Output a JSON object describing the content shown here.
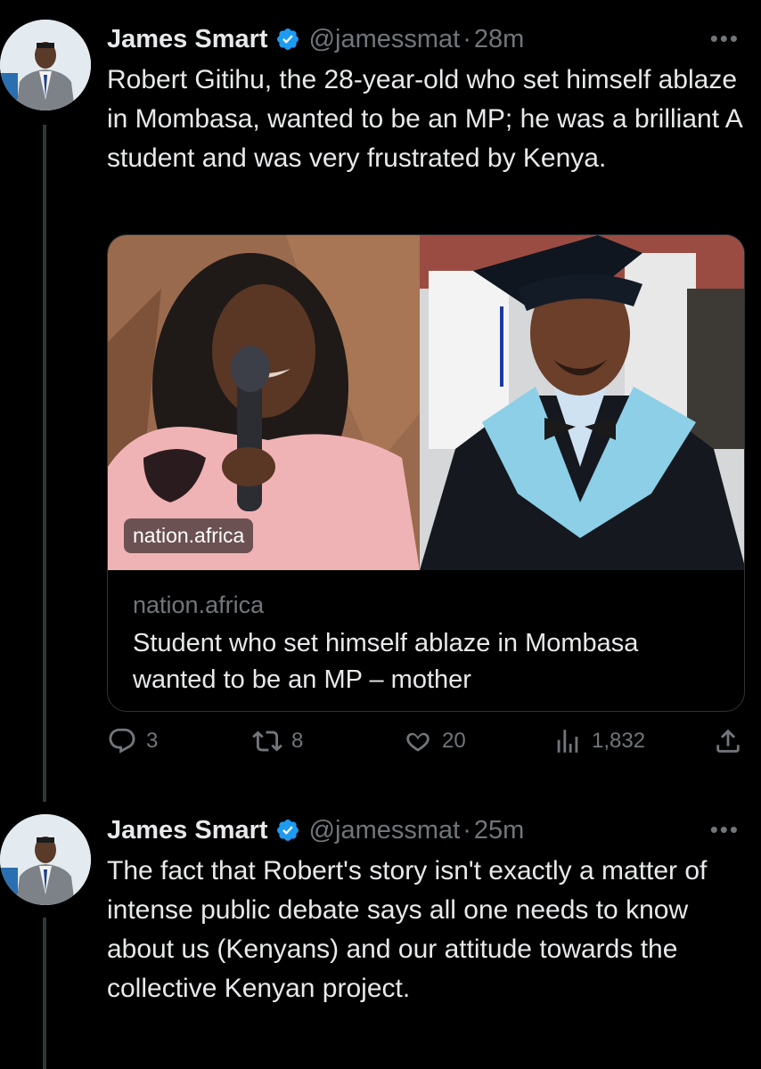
{
  "tweets": [
    {
      "author_name": "James Smart",
      "handle": "@jamessmat",
      "separator": "·",
      "time": "28m",
      "more": "•••",
      "text": "Robert Gitihu, the 28-year-old who set himself ablaze in Mombasa, wanted to be an MP; he was a brilliant A student and was very frustrated by Kenya.",
      "card": {
        "badge": "nation.africa",
        "domain": "nation.africa",
        "title": "Student who set himself ablaze in Mombasa wanted to be an MP – mother"
      },
      "actions": {
        "replies": "3",
        "reposts": "8",
        "likes": "20",
        "views": "1,832"
      }
    },
    {
      "author_name": "James Smart",
      "handle": "@jamessmat",
      "separator": "·",
      "time": "25m",
      "more": "•••",
      "text": "The fact that Robert's story isn't exactly a matter of intense public debate says all one needs to know about us (Kenyans) and our attitude towards the collective Kenyan project."
    }
  ],
  "colors": {
    "background": "#000000",
    "text": "#e7e9ea",
    "muted": "#71767b",
    "verified": "#1d9bf0"
  }
}
